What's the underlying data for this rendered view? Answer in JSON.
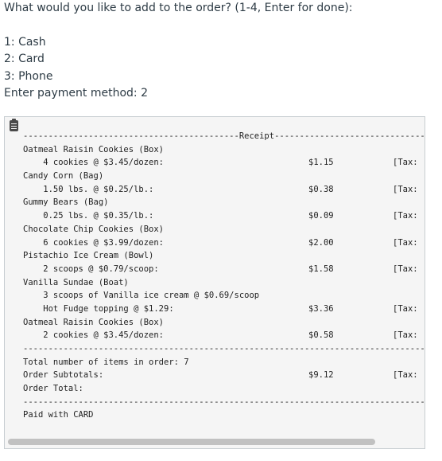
{
  "prompt": {
    "question": "What would you like to add to the order? (1-4, Enter for done):",
    "options": [
      "1: Cash",
      "2: Card",
      "3: Phone"
    ],
    "input_line": "Enter payment method: 2"
  },
  "receipt": {
    "header_line": "-------------------------------------------Receipt-------------------------------------",
    "items": [
      {
        "name": "Oatmeal Raisin Cookies (Box)",
        "detail": "    4 cookies @ $3.45/dozen:",
        "amount": "$1.15",
        "tax": "[Tax:"
      },
      {
        "name": "Candy Corn (Bag)",
        "detail": "    1.50 lbs. @ $0.25/lb.:",
        "amount": "$0.38",
        "tax": "[Tax:"
      },
      {
        "name": "Gummy Bears (Bag)",
        "detail": "    0.25 lbs. @ $0.35/lb.:",
        "amount": "$0.09",
        "tax": "[Tax:"
      },
      {
        "name": "Chocolate Chip Cookies (Box)",
        "detail": "    6 cookies @ $3.99/dozen:",
        "amount": "$2.00",
        "tax": "[Tax:"
      },
      {
        "name": "Pistachio Ice Cream (Bowl)",
        "detail": "    2 scoops @ $0.79/scoop:",
        "amount": "$1.58",
        "tax": "[Tax:"
      }
    ],
    "sundae": {
      "name": "Vanilla Sundae (Boat)",
      "detail1": "    3 scoops of Vanilla ice cream @ $0.69/scoop",
      "detail2": "    Hot Fudge topping @ $1.29:",
      "amount": "$3.36",
      "tax": "[Tax:"
    },
    "last_item": {
      "name": "Oatmeal Raisin Cookies (Box)",
      "detail": "    2 cookies @ $3.45/dozen:",
      "amount": "$0.58",
      "tax": "[Tax:"
    },
    "divider": "-----------------------------------------------------------------------------------------",
    "total_items": "Total number of items in order: 7",
    "subtotals_label": "Order Subtotals:",
    "subtotals_amount": "$9.12",
    "subtotals_tax": "[Tax:",
    "total_label": "Order Total:",
    "paid_with": "Paid with CARD"
  }
}
